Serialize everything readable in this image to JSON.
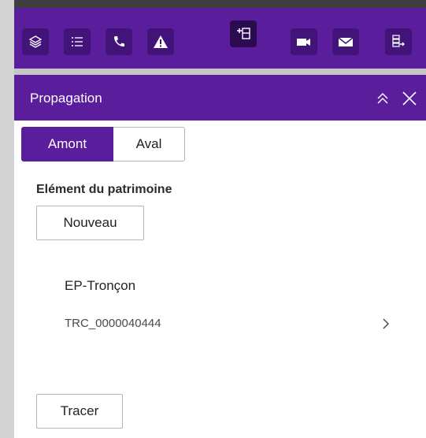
{
  "toolbar": {
    "buttons": [
      {
        "icon": "layers-icon"
      },
      {
        "icon": "list-icon"
      },
      {
        "icon": "phone-icon"
      },
      {
        "icon": "warning-icon"
      },
      {
        "icon": "network-trace-icon",
        "active": true
      },
      {
        "icon": "video-camera-icon"
      },
      {
        "icon": "mail-icon"
      },
      {
        "icon": "export-list-icon"
      }
    ]
  },
  "panel": {
    "title": "Propagation",
    "tabs": [
      {
        "label": "Amont",
        "selected": true
      },
      {
        "label": "Aval",
        "selected": false
      }
    ],
    "section_label": "Elément du patrimoine",
    "new_button": "Nouveau",
    "item": {
      "type": "EP-Tronçon",
      "id": "TRC_0000040444"
    },
    "trace_button": "Tracer"
  },
  "colors": {
    "accent": "#5a1d9c",
    "button_bg": "#421479",
    "active_button_bg": "#2b0a4f"
  }
}
